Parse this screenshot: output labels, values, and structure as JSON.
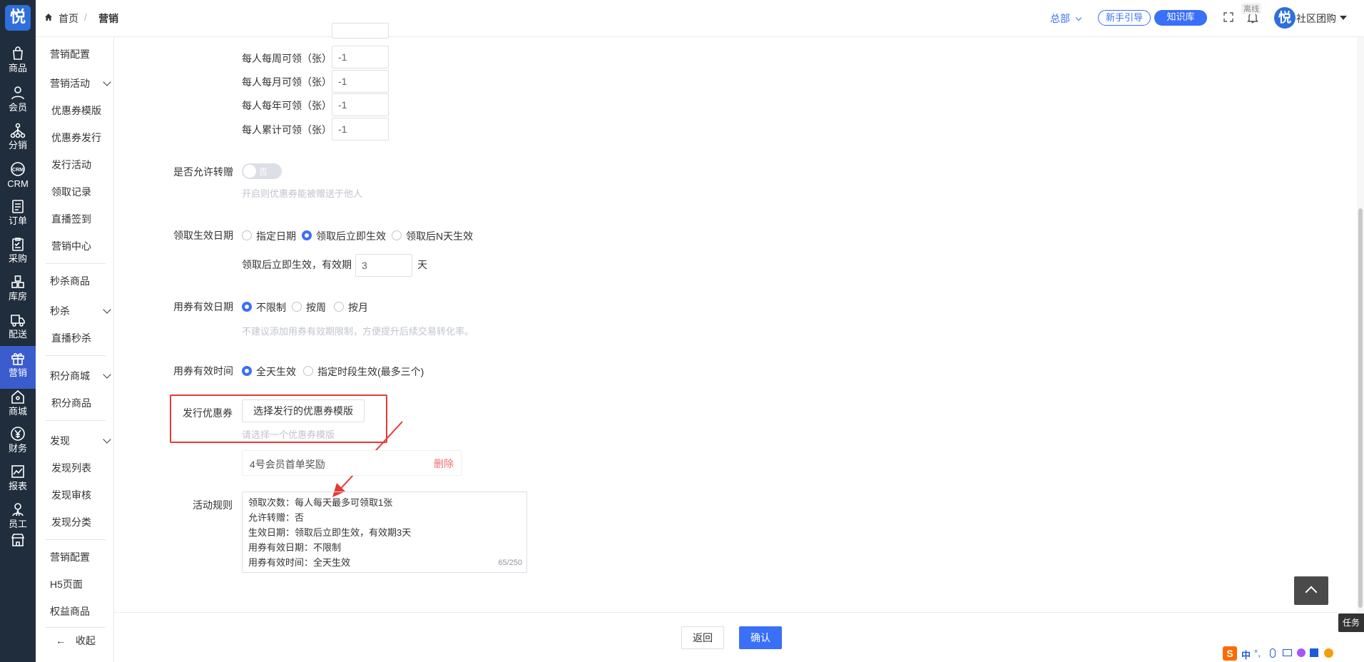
{
  "app": {
    "logo_text": "悦"
  },
  "rail": {
    "items": [
      {
        "label": "商品",
        "icon": "bag-icon"
      },
      {
        "label": "会员",
        "icon": "user-icon"
      },
      {
        "label": "分销",
        "icon": "network-icon"
      },
      {
        "label": "CRM",
        "icon": "crm-icon"
      },
      {
        "label": "订单",
        "icon": "order-icon"
      },
      {
        "label": "采购",
        "icon": "clipboard-icon"
      },
      {
        "label": "库房",
        "icon": "warehouse-icon"
      },
      {
        "label": "配送",
        "icon": "truck-icon"
      },
      {
        "label": "营销",
        "icon": "gift-icon"
      },
      {
        "label": "商城",
        "icon": "home-icon"
      },
      {
        "label": "财务",
        "icon": "yen-icon"
      },
      {
        "label": "报表",
        "icon": "chart-icon"
      },
      {
        "label": "员工",
        "icon": "staff-icon"
      },
      {
        "label": "",
        "icon": "store-icon"
      }
    ],
    "active_label": "营销"
  },
  "submenu": {
    "items": [
      "营销配置",
      "营销活动",
      "优惠券模版",
      "优惠券发行",
      "发行活动",
      "领取记录",
      "直播签到",
      "营销中心",
      "秒杀商品",
      "秒杀",
      "直播秒杀",
      "积分商城",
      "积分商品",
      "发现",
      "发现列表",
      "发现审核",
      "发现分类",
      "营销配置",
      "H5页面",
      "权益商品"
    ],
    "collapse_label": "收起"
  },
  "header": {
    "breadcrumb_home": "首页",
    "breadcrumb_sep": "/",
    "breadcrumb_current": "营销",
    "org": "总部",
    "guide_label": "新手引导",
    "kb_label": "知识库",
    "offline_badge": "离线",
    "user_name": "社区团购"
  },
  "form": {
    "limits": [
      {
        "label": "每人每周可领（张）",
        "value": "-1"
      },
      {
        "label": "每人每月可领（张）",
        "value": "-1"
      },
      {
        "label": "每人每年可领（张）",
        "value": "-1"
      },
      {
        "label": "每人累计可领（张）",
        "value": "-1"
      }
    ],
    "transfer": {
      "label": "是否允许转赠",
      "toggle_text": "否",
      "hint": "开启则优惠券能被赠送于他人"
    },
    "claim_date": {
      "label": "领取生效日期",
      "options": [
        "指定日期",
        "领取后立即生效",
        "领取后N天生效"
      ],
      "selected": 1,
      "validity_prefix": "领取后立即生效，有效期",
      "validity_value": "3",
      "validity_unit": "天"
    },
    "use_date": {
      "label": "用券有效日期",
      "options": [
        "不限制",
        "按周",
        "按月"
      ],
      "selected": 0,
      "hint": "不建议添加用券有效期限制，方便提升后续交易转化率。"
    },
    "use_time": {
      "label": "用券有效时间",
      "options": [
        "全天生效",
        "指定时段生效(最多三个)"
      ],
      "selected": 0
    },
    "issue": {
      "label": "发行优惠券",
      "button": "选择发行的优惠券模版",
      "hint": "请选择一个优惠券模版",
      "coupon_name": "4号会员首单奖励",
      "delete_label": "删除"
    },
    "rules": {
      "label": "活动规则",
      "lines": [
        "领取次数：每人每天最多可领取1张",
        "允许转赠：否",
        "生效日期：领取后立即生效，有效期3天",
        "用券有效日期：不限制",
        "用券有效时间：全天生效"
      ],
      "counter": "65/250"
    }
  },
  "footer": {
    "back_label": "返回",
    "confirm_label": "确认"
  },
  "float": {
    "task_label": "任务",
    "ime_items": [
      "中",
      "°,"
    ]
  },
  "colors": {
    "primary": "#3a6ff7",
    "rail_bg": "#1f2d3d",
    "active": "#3a5ccc",
    "danger": "#f56c6c",
    "highlight": "#e53935"
  }
}
